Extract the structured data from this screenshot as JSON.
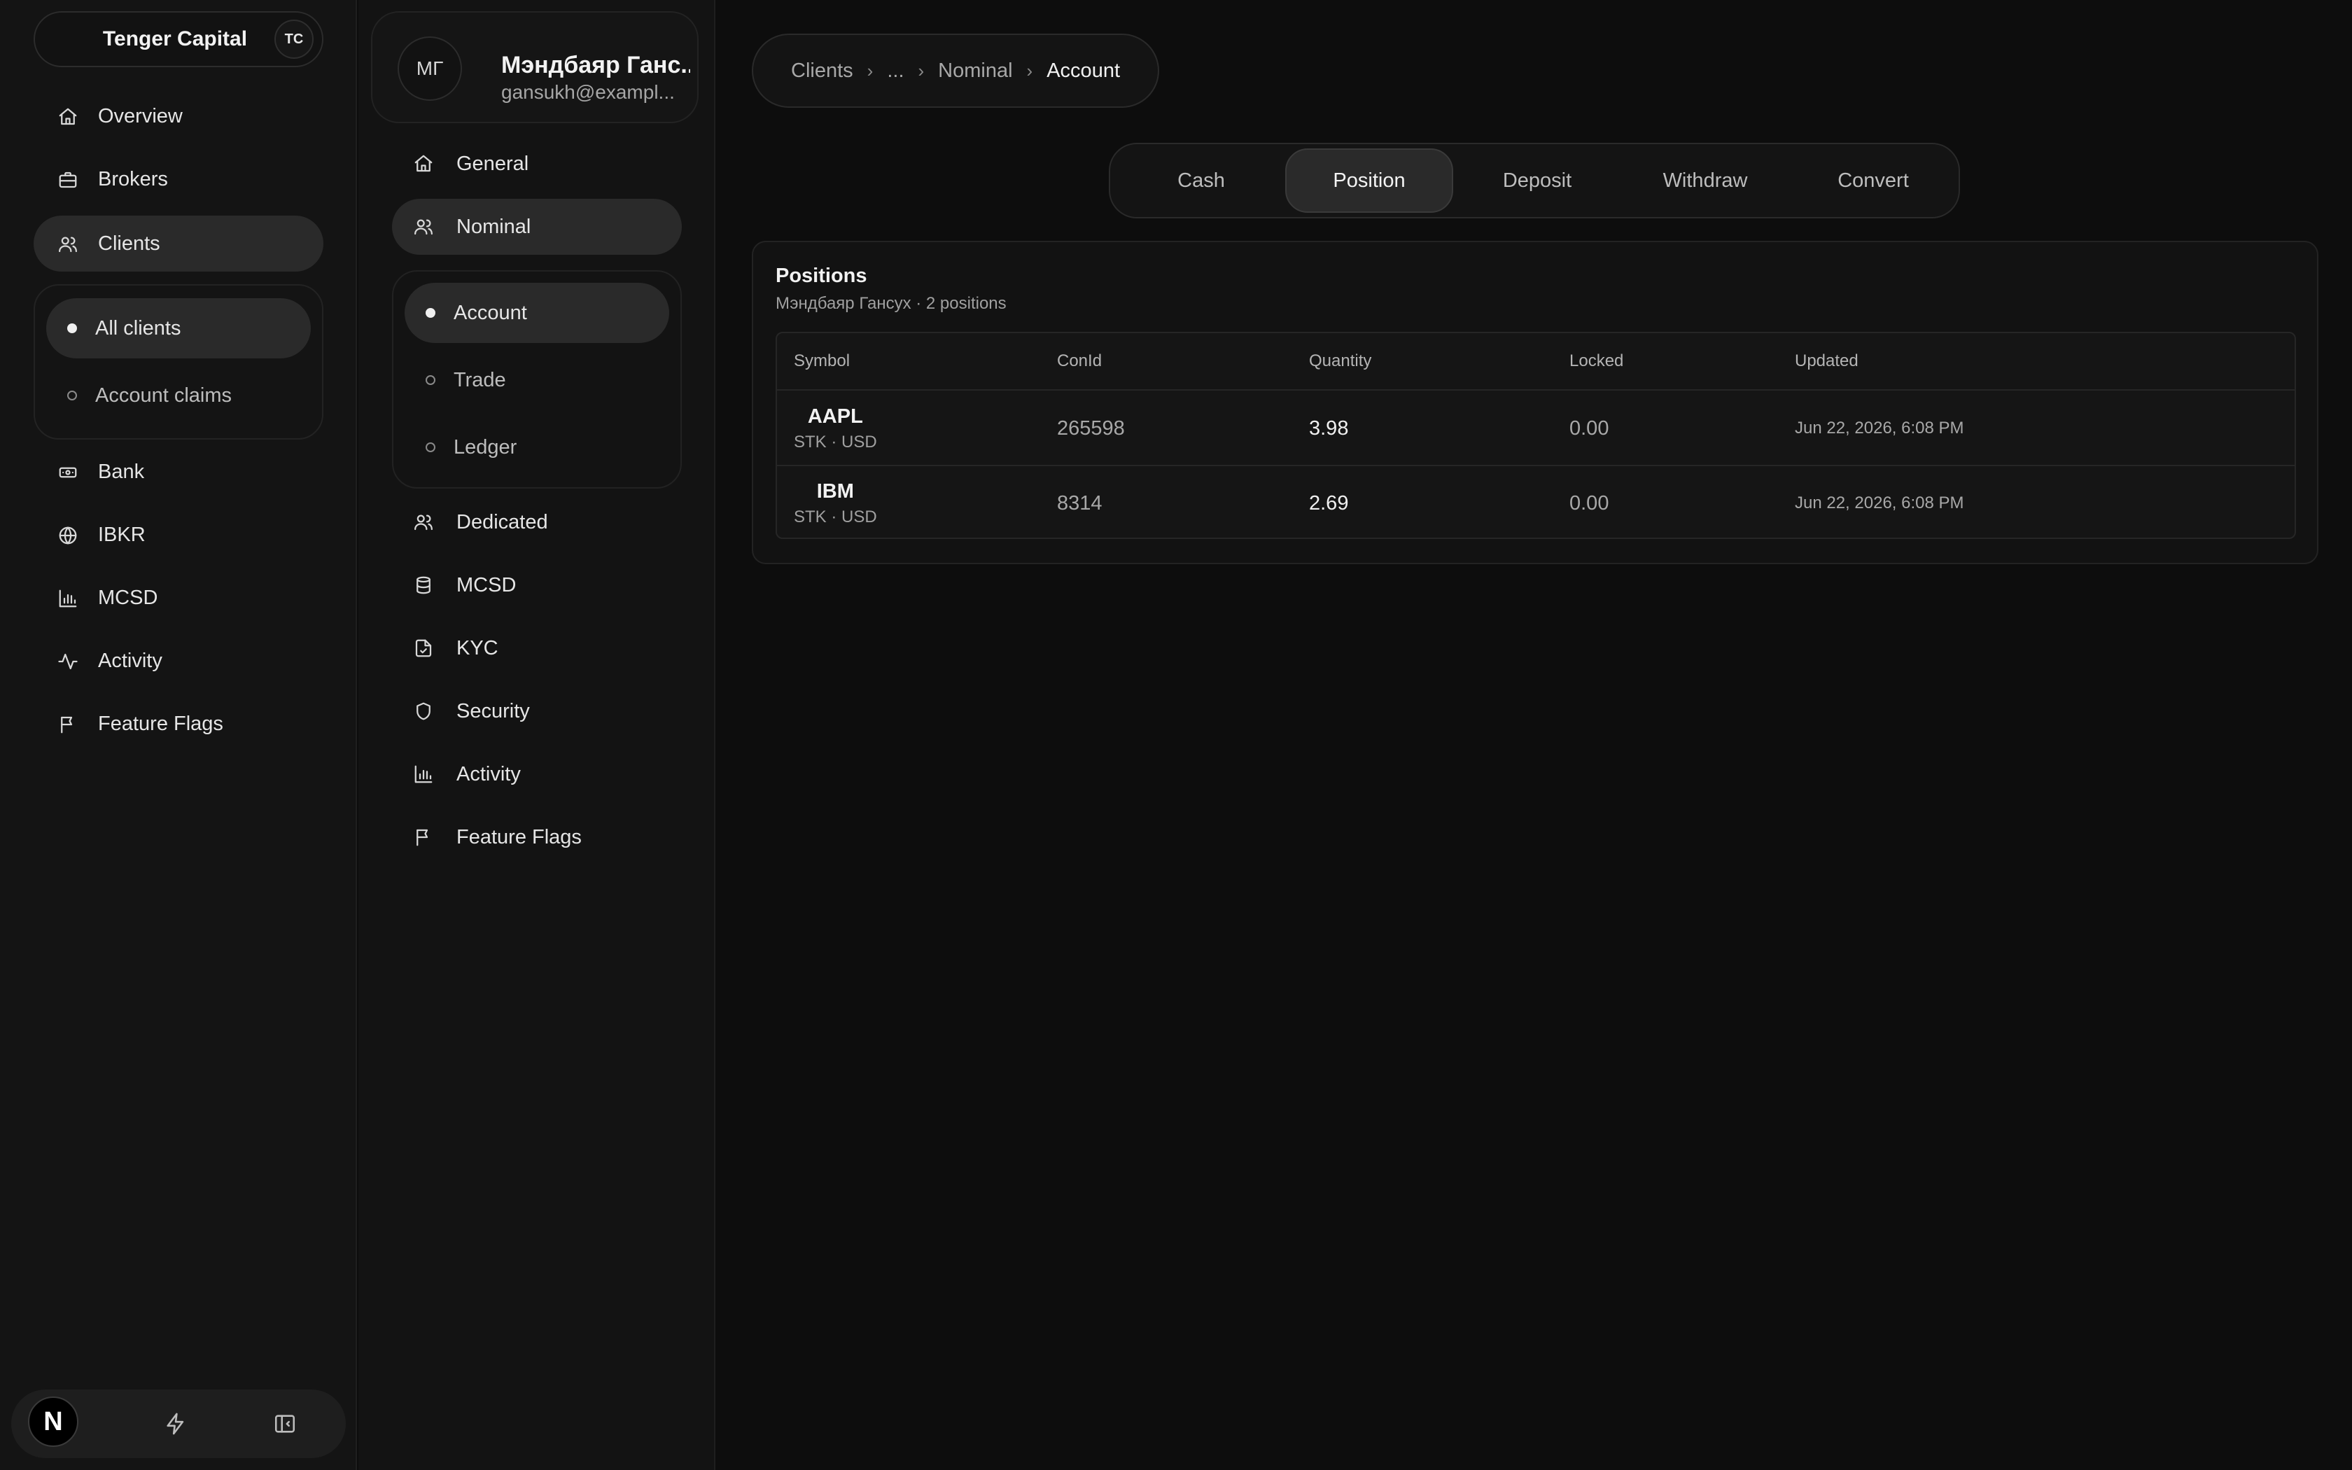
{
  "brand": {
    "name": "Tenger Capital",
    "badge": "TC"
  },
  "sidebar": {
    "items": [
      {
        "label": "Overview",
        "icon": "home-icon"
      },
      {
        "label": "Brokers",
        "icon": "briefcase-icon"
      },
      {
        "label": "Clients",
        "icon": "users-icon",
        "active": true
      },
      {
        "label": "Bank",
        "icon": "banknote-icon"
      },
      {
        "label": "IBKR",
        "icon": "globe-icon"
      },
      {
        "label": "MCSD",
        "icon": "bar-chart-icon"
      },
      {
        "label": "Activity",
        "icon": "activity-icon"
      },
      {
        "label": "Feature Flags",
        "icon": "flag-icon"
      }
    ],
    "clients_sub": [
      {
        "label": "All clients",
        "active": true
      },
      {
        "label": "Account claims",
        "active": false
      }
    ],
    "footer": {
      "logo_letter": "N"
    }
  },
  "client": {
    "initials": "МГ",
    "name": "Мэндбаяр Ганс...",
    "email": "gansukh@exampl..."
  },
  "client_nav": {
    "general": "General",
    "nominal": "Nominal",
    "nominal_sub": [
      "Account",
      "Trade",
      "Ledger"
    ],
    "dedicated": "Dedicated",
    "mcsd": "MCSD",
    "kyc": "KYC",
    "security": "Security",
    "activity": "Activity",
    "feature_flags": "Feature Flags"
  },
  "breadcrumb": [
    "Clients",
    "...",
    "Nominal",
    "Account"
  ],
  "tabs": [
    "Cash",
    "Position",
    "Deposit",
    "Withdraw",
    "Convert"
  ],
  "active_tab": "Position",
  "positions": {
    "title": "Positions",
    "subtitle": "Мэндбаяр Гансух · 2 positions",
    "columns": [
      "Symbol",
      "ConId",
      "Quantity",
      "Locked",
      "Updated"
    ],
    "rows": [
      {
        "symbol": "AAPL",
        "meta": "STK · USD",
        "conid": "265598",
        "quantity": "3.98",
        "locked": "0.00",
        "updated": "Jun 22, 2026, 6:08 PM"
      },
      {
        "symbol": "IBM",
        "meta": "STK · USD",
        "conid": "8314",
        "quantity": "2.69",
        "locked": "0.00",
        "updated": "Jun 22, 2026, 6:08 PM"
      }
    ]
  }
}
